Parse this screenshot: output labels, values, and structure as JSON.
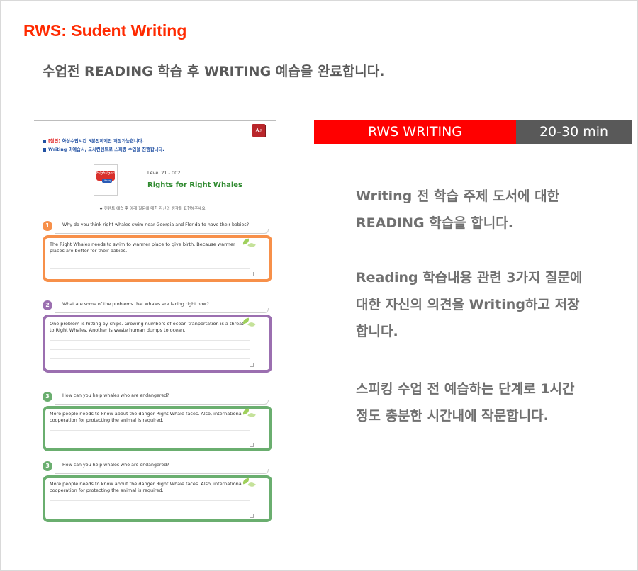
{
  "header": {
    "title": "RWS: Sudent Writing",
    "subtitle": "수업전 READING 학습 후 WRITING 예습을 완료합니다."
  },
  "worksheet": {
    "aa_label": "Aa",
    "notice1_tag": "[참안]",
    "notice1_text": " 화상수업시간 5분전까지만 저장가능합니다.",
    "notice2_text": "Writing 미예습시, 도서컨텐트로 스피킹 수업을 진행합니다.",
    "logo_text": "Highlights",
    "logo_sub": "Library",
    "level": "Level 21 - 002",
    "book_title": "Rights for Right Whales",
    "instruction": "♠ 컨텐트 예습 후 아래 질문에 대한 자신의 생각을 표현해주세요.",
    "questions": [
      {
        "number": "1",
        "question": "Why do you think right whales swim near Georgia and Florida to have their babies?",
        "answer": "The Right Whales needs to swim to warmer place to give birth. Because warmer places are better for their babies.",
        "color": "#f7904a"
      },
      {
        "number": "2",
        "question": "What are some of the problems that whales are facing right now?",
        "answer": "One problem is hitting by ships. Growing numbers of ocean tranportation is a threat to Right Whales. Another is waste human dumps to ocean.",
        "color": "#9b6fb0"
      },
      {
        "number": "3",
        "question": "How can you help whales who are endangered?",
        "answer": "More people needs to know about the danger Right Whale faces. Also, international cooperation for protecting the animal is required.",
        "color": "#6aae6f"
      },
      {
        "number": "3",
        "question": "How can you help whales who are endangered?",
        "answer": "More people needs to know about the danger Right Whale faces. Also, international cooperation for protecting the animal is required.",
        "color": "#6aae6f"
      }
    ]
  },
  "panel": {
    "bar_label": "RWS WRITING",
    "time_label": "20-30 min",
    "desc1_line1": "Writing 전 학습 주제 도서에 대한",
    "desc1_line2": "READING 학습을 합니다.",
    "desc2_line1": "Reading 학습내용 관련 3가지 질문에",
    "desc2_line2": "대한 자신의 의견을 Writing하고 저장",
    "desc2_line3": "합니다.",
    "desc3_line1": "스피킹 수업 전 예습하는 단계로 1시간",
    "desc3_line2": "정도 충분한 시간내에 작문합니다."
  },
  "colors": {
    "title_red": "#ff2a00",
    "bar_red": "#ff0000",
    "bar_gray": "#595959"
  }
}
